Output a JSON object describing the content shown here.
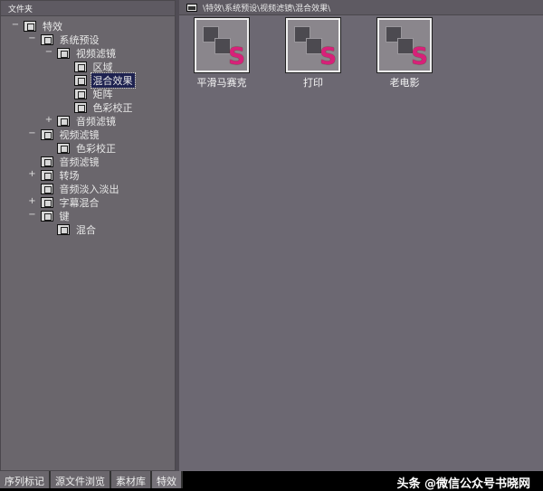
{
  "left_panel": {
    "title": "文件夹",
    "tree": [
      {
        "label": "特效",
        "level": 0,
        "exp": "−"
      },
      {
        "label": "系统预设",
        "level": 1,
        "exp": "−"
      },
      {
        "label": "视频滤镜",
        "level": 2,
        "exp": "−"
      },
      {
        "label": "区域",
        "level": 3,
        "exp": ""
      },
      {
        "label": "混合效果",
        "level": 3,
        "exp": "",
        "selected": true
      },
      {
        "label": "矩阵",
        "level": 3,
        "exp": ""
      },
      {
        "label": "色彩校正",
        "level": 3,
        "exp": ""
      },
      {
        "label": "音频滤镜",
        "level": 2,
        "exp": "+"
      },
      {
        "label": "视频滤镜",
        "level": 1,
        "exp": "−"
      },
      {
        "label": "色彩校正",
        "level": 2,
        "exp": ""
      },
      {
        "label": "音频滤镜",
        "level": 1,
        "exp": ""
      },
      {
        "label": "转场",
        "level": 1,
        "exp": "+"
      },
      {
        "label": "音频淡入淡出",
        "level": 1,
        "exp": ""
      },
      {
        "label": "字幕混合",
        "level": 1,
        "exp": "+"
      },
      {
        "label": "键",
        "level": 1,
        "exp": "−"
      },
      {
        "label": "混合",
        "level": 2,
        "exp": ""
      }
    ]
  },
  "right_panel": {
    "breadcrumb": "\\特效\\系统预设\\视频滤镜\\混合效果\\",
    "items": [
      {
        "label": "平滑马赛克",
        "badge": "S"
      },
      {
        "label": "打印",
        "badge": "S"
      },
      {
        "label": "老电影",
        "badge": "S"
      }
    ]
  },
  "tabs": [
    {
      "label": "序列标记"
    },
    {
      "label": "源文件浏览"
    },
    {
      "label": "素材库"
    },
    {
      "label": "特效",
      "active": true
    }
  ],
  "watermark": "头条 @微信公众号书晓网"
}
